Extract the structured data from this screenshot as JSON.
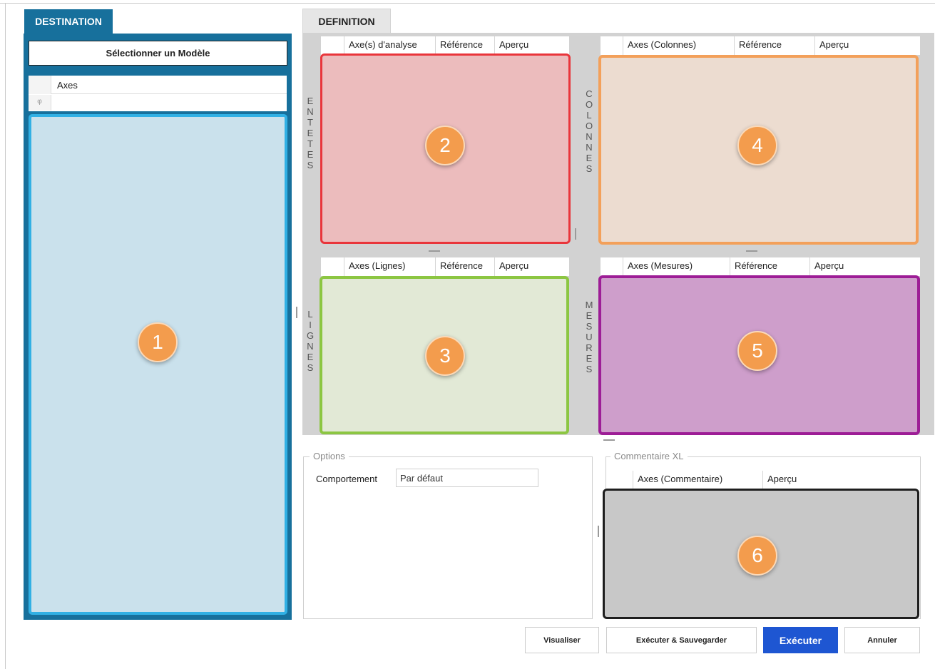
{
  "destination": {
    "tab_label": "DESTINATION",
    "select_model_label": "Sélectionner un Modèle",
    "axes_header": "Axes",
    "filter_glyph": "φ",
    "zone_number": "1"
  },
  "definition": {
    "tab_label": "DEFINITION",
    "entetes": {
      "side_label": [
        "E",
        "N",
        "T",
        "E",
        "T",
        "E",
        "S"
      ],
      "columns": [
        "Axe(s) d'analyse",
        "Référence",
        "Aperçu"
      ],
      "zone_number": "2"
    },
    "colonnes": {
      "side_label": [
        "C",
        "O",
        "L",
        "O",
        "N",
        "N",
        "E",
        "S"
      ],
      "columns": [
        "Axes (Colonnes)",
        "Référence",
        "Aperçu"
      ],
      "zone_number": "4"
    },
    "lignes": {
      "side_label": [
        "L",
        "I",
        "G",
        "N",
        "E",
        "S"
      ],
      "columns": [
        "Axes (Lignes)",
        "Référence",
        "Aperçu"
      ],
      "zone_number": "3"
    },
    "mesures": {
      "side_label": [
        "M",
        "E",
        "S",
        "U",
        "R",
        "E",
        "S"
      ],
      "columns": [
        "Axes (Mesures)",
        "Référence",
        "Aperçu"
      ],
      "zone_number": "5"
    }
  },
  "options": {
    "group_title": "Options",
    "behavior_label": "Comportement",
    "behavior_value": "Par défaut"
  },
  "commentaire": {
    "group_title": "Commentaire XL",
    "columns": [
      "Axes (Commentaire)",
      "Aperçu"
    ],
    "zone_number": "6"
  },
  "buttons": {
    "preview": "Visualiser",
    "run_save": "Exécuter & Sauvegarder",
    "run": "Exécuter",
    "cancel": "Annuler"
  },
  "colors": {
    "destination_blue": "#17709c",
    "zone1_border": "#31b0e4",
    "zone2_border": "#e9353b",
    "zone3_border": "#8cc642",
    "zone4_border": "#f3a05a",
    "zone5_border": "#9d1d96",
    "zone6_border": "#1e1e1e",
    "badge_orange": "#f39c4d",
    "primary_button": "#1e56d2"
  }
}
